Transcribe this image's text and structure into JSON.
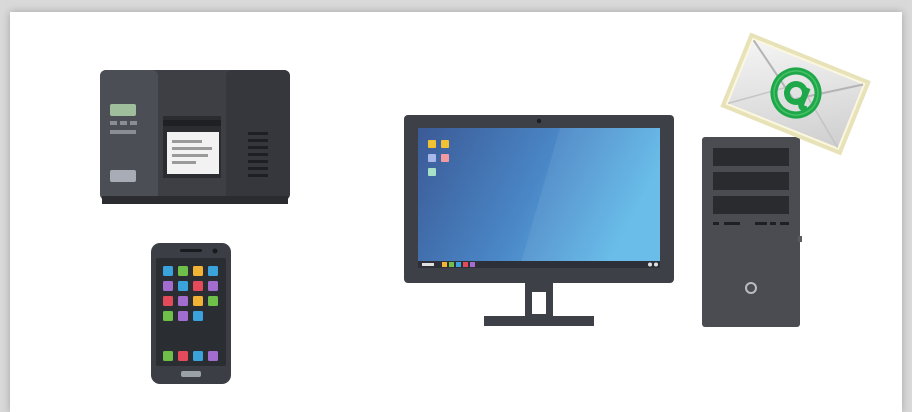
{
  "scene": {
    "background_color": "#d9d9d9",
    "card_color": "#ffffff",
    "devices": [
      {
        "id": "label-printer",
        "icon": "thermal-label-printer-icon",
        "color": "#3d3f44"
      },
      {
        "id": "smartphone",
        "icon": "smartphone-icon",
        "color": "#2c2f34"
      },
      {
        "id": "desktop-monitor",
        "icon": "desktop-monitor-icon",
        "screen_gradient": [
          "#3a5b96",
          "#5ab3e6"
        ]
      },
      {
        "id": "pc-tower",
        "icon": "pc-tower-icon",
        "color": "#4a4c52"
      },
      {
        "id": "email-envelope",
        "icon": "email-at-envelope-icon",
        "accent": "#1fa84a"
      }
    ]
  }
}
